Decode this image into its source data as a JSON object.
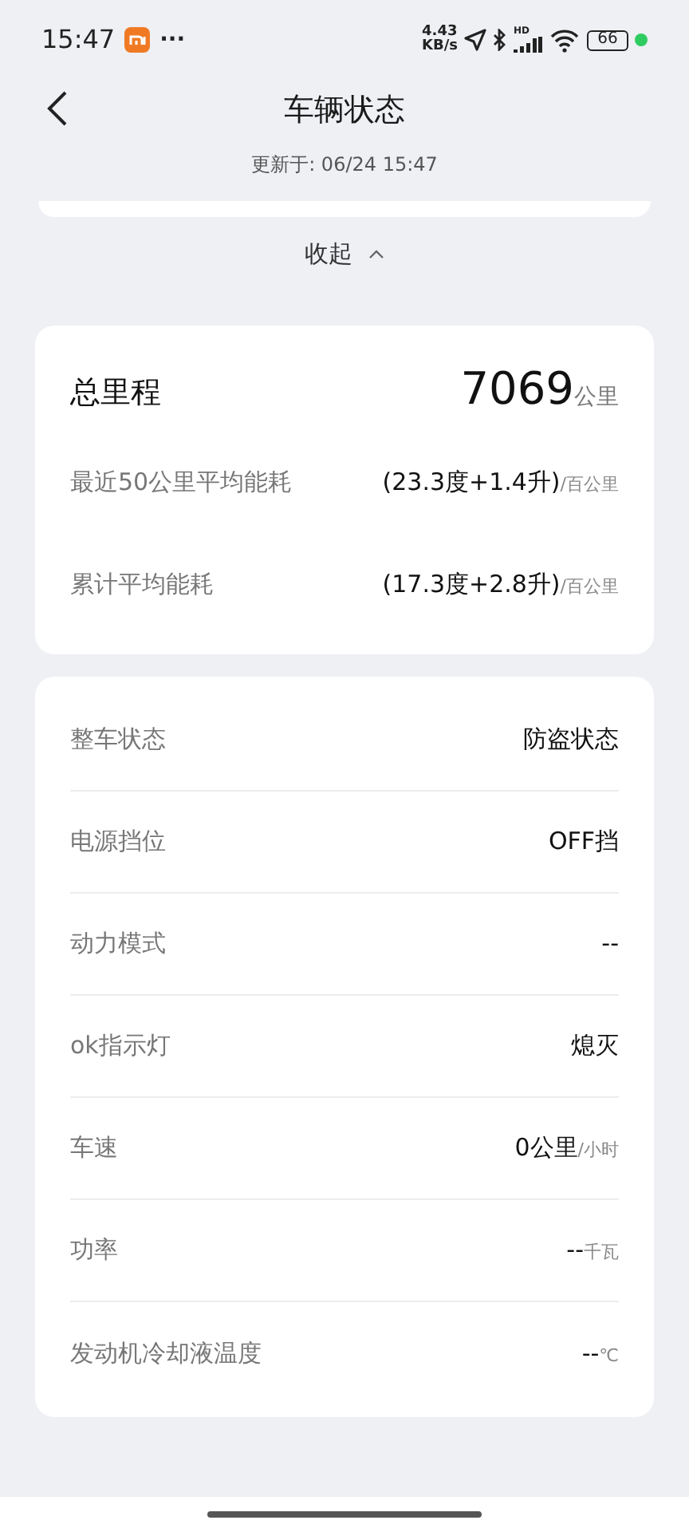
{
  "status_bar": {
    "time": "15:47",
    "more": "···",
    "net_speed_value": "4.43",
    "net_speed_unit": "KB/s",
    "hd": "HD",
    "battery": "66"
  },
  "header": {
    "title": "车辆状态",
    "updated": "更新于: 06/24 15:47"
  },
  "collapse": {
    "label": "收起"
  },
  "mileage_card": {
    "label": "总里程",
    "value": "7069",
    "unit": "公里",
    "rows": [
      {
        "label": "最近50公里平均能耗",
        "value": "(23.3度+1.4升)",
        "unit": "/百公里"
      },
      {
        "label": "累计平均能耗",
        "value": "(17.3度+2.8升)",
        "unit": "/百公里"
      }
    ]
  },
  "status_card": {
    "rows": [
      {
        "label": "整车状态",
        "value": "防盗状态"
      },
      {
        "label": "电源挡位",
        "value": "OFF挡"
      },
      {
        "label": "动力模式",
        "value": "--"
      },
      {
        "label": "ok指示灯",
        "value": "熄灭"
      },
      {
        "label": "车速",
        "value": "0公里",
        "unit": "/小时"
      },
      {
        "label": "功率",
        "value": "--",
        "unit": "千瓦"
      },
      {
        "label": "发动机冷却液温度",
        "value": "--",
        "unit": "℃"
      }
    ]
  }
}
